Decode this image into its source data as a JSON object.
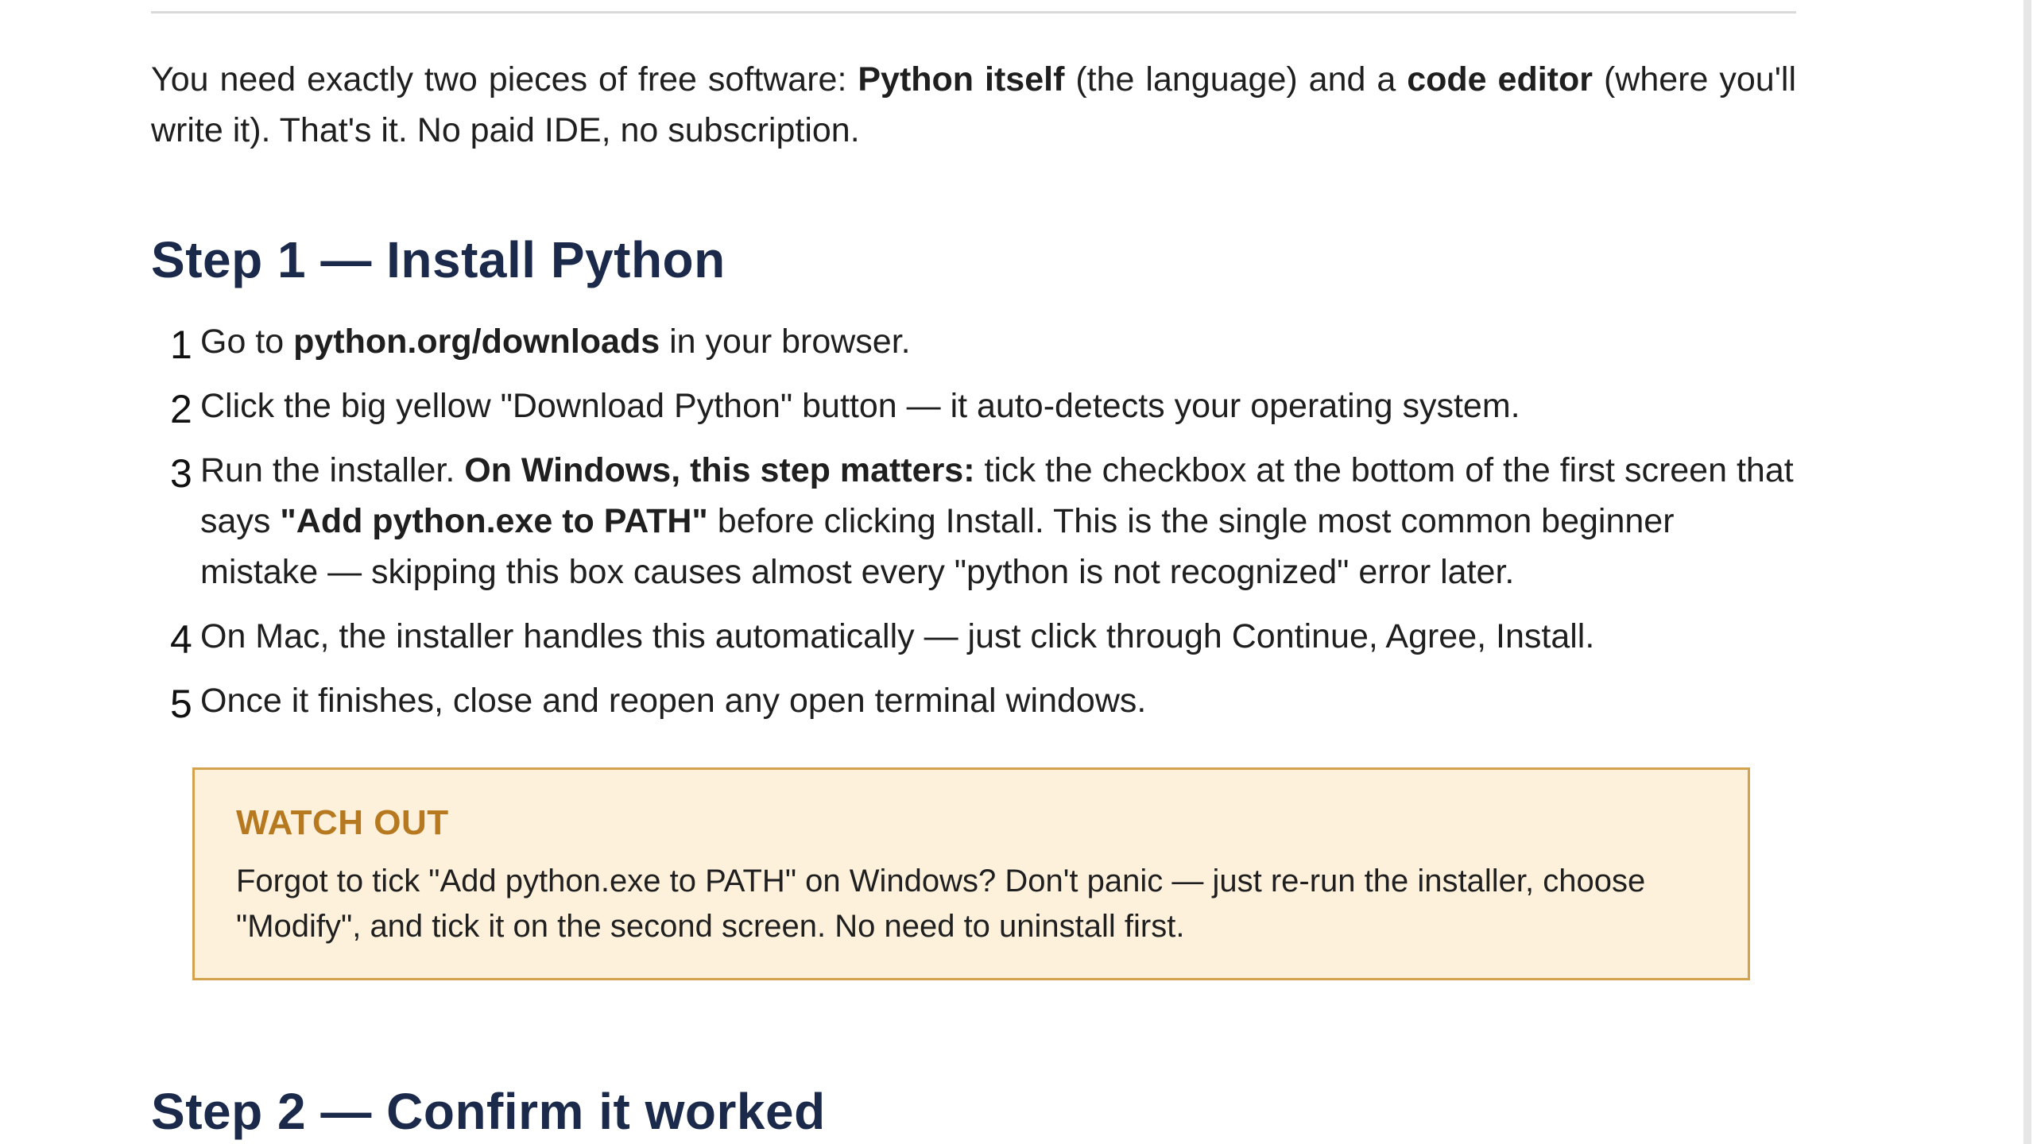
{
  "intro": {
    "t1": "You need exactly two pieces of free software: ",
    "b1": "Python itself",
    "t2": " (the language) and a ",
    "b2": "code editor",
    "t3": " (where you'll write it). That's it. No paid IDE, no subscription."
  },
  "step1": {
    "heading": "Step 1 — Install Python",
    "items": [
      {
        "num": "1",
        "t1": "Go to ",
        "b1": "python.org/downloads",
        "t2": " in your browser."
      },
      {
        "num": "2",
        "t1": "Click the big yellow \"Download Python\" button — it auto-detects your operating system."
      },
      {
        "num": "3",
        "t1": "Run the installer. ",
        "b1": "On Windows, this step matters:",
        "t2": " tick the checkbox at the bottom of the first screen that says ",
        "b2": "\"Add python.exe to PATH\"",
        "t3": " before clicking Install. This is the single most common beginner mistake — skipping this box causes almost every \"python is not recognized\" error later."
      },
      {
        "num": "4",
        "t1": "On Mac, the installer handles this automatically — just click through Continue, Agree, Install."
      },
      {
        "num": "5",
        "t1": "Once it finishes, close and reopen any open terminal windows."
      }
    ]
  },
  "callout": {
    "title": "WATCH OUT",
    "body": "Forgot to tick \"Add python.exe to PATH\" on Windows? Don't panic — just re-run the installer, choose \"Modify\", and tick it on the second screen. No need to uninstall first."
  },
  "step2": {
    "heading": "Step 2 — Confirm it worked"
  },
  "colors": {
    "heading": "#1b2a4a",
    "callout_border": "#d4a24c",
    "callout_bg": "#fdf1dc",
    "callout_title": "#b7791f"
  }
}
